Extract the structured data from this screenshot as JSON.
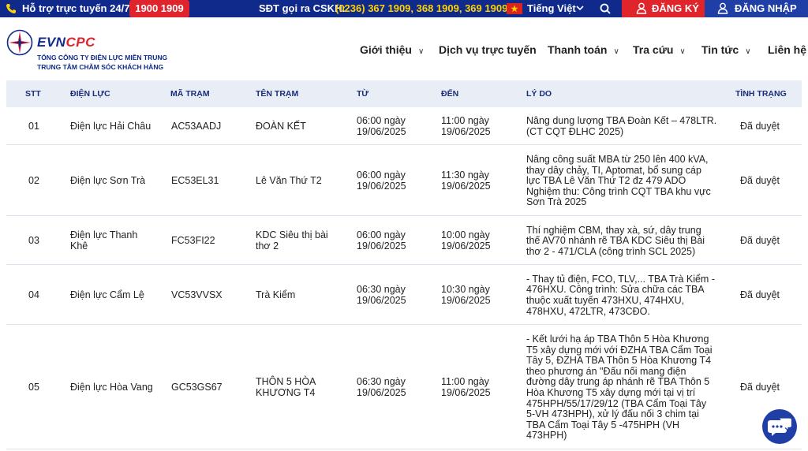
{
  "topbar": {
    "hotline_label": "Hỗ trợ trực tuyến 24/7:",
    "hotline_number": "1900 1909",
    "cskh_label": "SĐT gọi ra CSKH:",
    "cskh_numbers": "(0236) 367 1909, 368 1909, 369 1909",
    "language": "Tiếng Việt",
    "register_label": "ĐĂNG KÝ",
    "login_label": "ĐĂNG NHẬP",
    "colors": {
      "bar": "#0f2a8a",
      "red": "#e0242c",
      "yellow": "#ffd200"
    }
  },
  "header": {
    "logo_evn": "EVN",
    "logo_cpc": "CPC",
    "logo_sub1": "TỔNG CÔNG TY ĐIỆN LỰC MIỀN TRUNG",
    "logo_sub2": "TRUNG TÂM CHĂM SÓC KHÁCH HÀNG",
    "nav": [
      "Giới thiệu",
      "Dịch vụ trực tuyến",
      "Thanh toán",
      "Tra cứu",
      "Tin tức",
      "Liên hệ"
    ]
  },
  "table": {
    "columns": [
      "STT",
      "ĐIỆN LỰC",
      "MÃ TRẠM",
      "TÊN TRẠM",
      "TỪ",
      "ĐẾN",
      "LÝ DO",
      "TÌNH TRẠNG"
    ],
    "rows": [
      {
        "stt": "01",
        "dien_luc": [
          "Điện lực Hải Châu"
        ],
        "ma_tram": "AC53AADJ",
        "ten_tram": [
          "ĐOÀN KẾT"
        ],
        "tu": [
          "06:00 ngày",
          "19/06/2025"
        ],
        "den": [
          "11:00 ngày",
          "19/06/2025"
        ],
        "ly_do": [
          "Nâng dung lượng TBA Đoàn Kết – 478LTR.",
          "(CT CQT ĐLHC 2025)"
        ],
        "tinh_trang": "Đã duyệt"
      },
      {
        "stt": "02",
        "dien_luc": [
          "Điện lực Sơn Trà"
        ],
        "ma_tram": "EC53EL31",
        "ten_tram": [
          "Lê Văn Thứ T2"
        ],
        "tu": [
          "06:00 ngày",
          "19/06/2025"
        ],
        "den": [
          "11:30 ngày",
          "19/06/2025"
        ],
        "ly_do": [
          "Nâng công suất MBA từ 250 lên 400 kVA,",
          "thay dây chảy, TI, Aptomat, bổ sung cáp",
          "lực TBA Lê Văn Thứ T2 đz 479 ADO",
          "Nghiệm thu: Công trình CQT TBA khu vực",
          "Sơn Trà 2025"
        ],
        "tinh_trang": "Đã duyệt"
      },
      {
        "stt": "03",
        "dien_luc": [
          "Điện lực Thanh",
          "Khê"
        ],
        "ma_tram": "FC53FI22",
        "ten_tram": [
          "KDC Siêu thị bài",
          "thơ 2"
        ],
        "tu": [
          "06:00 ngày",
          "19/06/2025"
        ],
        "den": [
          "10:00 ngày",
          "19/06/2025"
        ],
        "ly_do": [
          "Thí nghiệm CBM, thay xà, sứ, dây trung",
          "thế AV70 nhánh rẽ TBA KDC Siêu thị Bài",
          "thơ 2 - 471/CLA (công trình SCL 2025)"
        ],
        "tinh_trang": "Đã duyệt"
      },
      {
        "stt": "04",
        "dien_luc": [
          "Điện lực Cẩm Lệ"
        ],
        "ma_tram": "VC53VVSX",
        "ten_tram": [
          "Trà Kiểm"
        ],
        "tu": [
          "06:30 ngày",
          "19/06/2025"
        ],
        "den": [
          "10:30 ngày",
          "19/06/2025"
        ],
        "ly_do": [
          "- Thay tủ điện, FCO, TLV,... TBA Trà Kiểm -",
          "476HXU. Công trình: Sửa chữa các TBA",
          "thuộc xuất tuyến 473HXU, 474HXU,",
          "478HXU, 472LTR, 473CĐO."
        ],
        "tinh_trang": "Đã duyệt"
      },
      {
        "stt": "05",
        "dien_luc": [
          "Điện lực Hòa Vang"
        ],
        "ma_tram": "GC53GS67",
        "ten_tram": [
          "THÔN 5 HÒA",
          "KHƯƠNG T4"
        ],
        "tu": [
          "06:30 ngày",
          "19/06/2025"
        ],
        "den": [
          "11:00 ngày",
          "19/06/2025"
        ],
        "ly_do": [
          "- Kết lưới hạ áp TBA Thôn 5 Hòa Khương",
          "T5 xây dựng mới với ĐZHA TBA Cẩm Toại",
          "Tây 5, ĐZHA TBA Thôn 5 Hòa Khương T4",
          "theo phương án \"Đấu nối mang điện",
          "đường dây trung áp nhánh rẽ TBA Thôn 5",
          "Hòa Khương T5 xây dựng mới tại vị trí",
          "475HPH/55/17/29/12 (TBA Cẩm Toại Tây",
          "5-VH 473HPH), xử lý đấu nối 3 chim tại",
          "TBA Cẩm Toại Tây 5 -475HPH (VH",
          "473HPH)"
        ],
        "tinh_trang": "Đã duyệt"
      }
    ]
  },
  "chat": {
    "icon": "chat-icon"
  }
}
